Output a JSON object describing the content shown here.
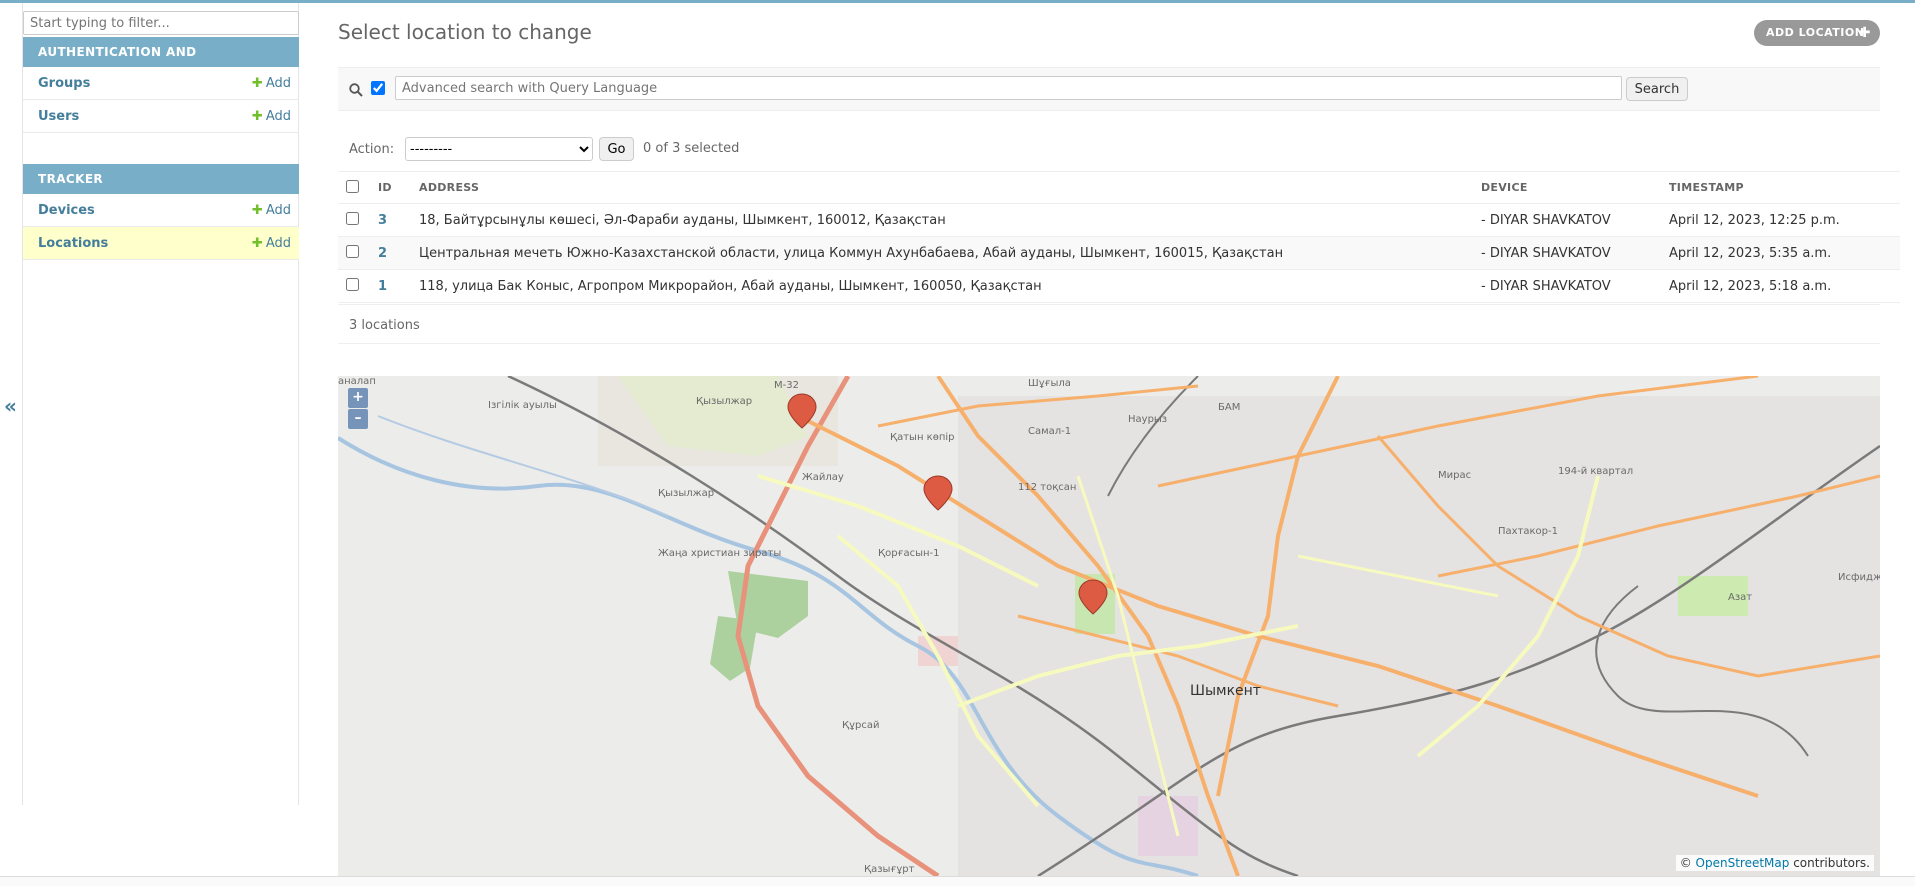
{
  "sidebar": {
    "filter_placeholder": "Start typing to filter...",
    "modules": [
      {
        "title": "Authentication and Authorization",
        "items": [
          {
            "label": "Groups",
            "add": "Add"
          },
          {
            "label": "Users",
            "add": "Add"
          }
        ]
      },
      {
        "title": "Tracker",
        "items": [
          {
            "label": "Devices",
            "add": "Add"
          },
          {
            "label": "Locations",
            "add": "Add"
          }
        ]
      }
    ],
    "collapse_glyph": "«"
  },
  "page": {
    "title": "Select location to change",
    "add_button": "ADD LOCATION",
    "add_glyph": "✚"
  },
  "search": {
    "placeholder": "Advanced search with Query Language",
    "button": "Search"
  },
  "actions": {
    "label": "Action:",
    "selected_option": "---------",
    "go": "Go",
    "counter": "0 of 3 selected"
  },
  "table": {
    "headers": [
      "ID",
      "ADDRESS",
      "DEVICE",
      "TIMESTAMP"
    ],
    "rows": [
      {
        "id": "3",
        "address": "18, Байтұрсынұлы көшесі, Әл-Фараби ауданы, Шымкент, 160012, Қазақстан",
        "device": "- DIYAR SHAVKATOV",
        "timestamp": "April 12, 2023, 12:25 p.m."
      },
      {
        "id": "2",
        "address": "Центральная мечеть Южно-Казахстанской области, улица Коммун Ахунбабаева, Абай ауданы, Шымкент, 160015, Қазақстан",
        "device": "- DIYAR SHAVKATOV",
        "timestamp": "April 12, 2023, 5:35 a.m."
      },
      {
        "id": "1",
        "address": "118, улица Бак Коныс, Агропром Микрорайон, Абай ауданы, Шымкент, 160050, Қазақстан",
        "device": "- DIYAR SHAVKATOV",
        "timestamp": "April 12, 2023, 5:18 a.m."
      }
    ],
    "footer": "3 locations"
  },
  "map": {
    "zoom_in": "+",
    "zoom_out": "–",
    "attribution_prefix": "©",
    "attribution_link": "OpenStreetMap",
    "attribution_suffix": "contributors.",
    "labels": {
      "city": "Шымкент",
      "izgilik": "Ізгілік ауылы",
      "kyzylzhar": "Қызылжар",
      "zhailau": "Жайлау",
      "katyn": "Қатын көпір",
      "kyzylzhar2": "Қызылжар",
      "cemetery": "Жаңа христиан зираты",
      "kursai": "Құрсай",
      "azat": "Азат",
      "m32": "М-32",
      "samal": "Самал-1",
      "naurys": "Наурыз",
      "bam": "БАМ",
      "shugyla": "Шұғыла",
      "mirass": "Мирас",
      "pakhtakor": "Пахтакор-1",
      "isfijab": "Исфиджаб",
      "kaztuge": "Қазығұрт",
      "toksan": "112 тоқсан",
      "kv194": "194-й квартал",
      "korgasyn": "Қорғасын-1",
      "edge": "аналап"
    },
    "accent_road": "#e8927c",
    "marker_color": "#dd5a43"
  },
  "colors": {
    "header": "#79aec8",
    "link": "#447e9b",
    "add_plus": "#70bf2b",
    "current_row": "#ffffcc"
  }
}
